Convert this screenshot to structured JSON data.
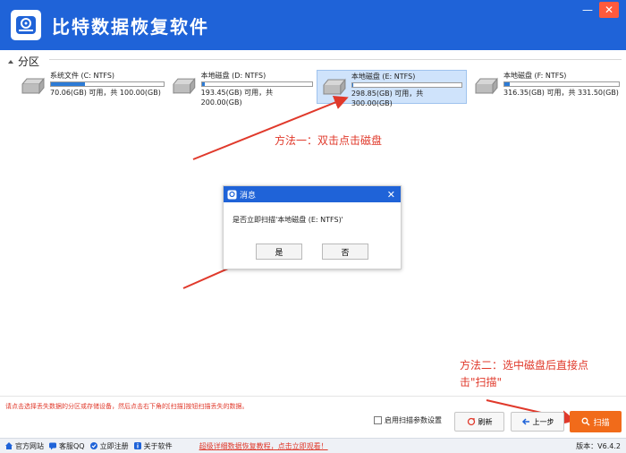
{
  "app": {
    "title": "比特数据恢复软件"
  },
  "window": {
    "minimize_glyph": "—",
    "close_glyph": "✕"
  },
  "partitions": {
    "title": "分区",
    "items": [
      {
        "name": "系统文件 (C: NTFS)",
        "usage": "70.06(GB) 可用，共 100.00(GB)",
        "fill": 0.3,
        "selected": false
      },
      {
        "name": "本地磁盘 (D: NTFS)",
        "usage": "193.45(GB) 可用，共 200.00(GB)",
        "fill": 0.03,
        "selected": false
      },
      {
        "name": "本地磁盘 (E: NTFS)",
        "usage": "298.85(GB) 可用，共 300.00(GB)",
        "fill": 0.01,
        "selected": true
      },
      {
        "name": "本地磁盘 (F: NTFS)",
        "usage": "316.35(GB) 可用，共 331.50(GB)",
        "fill": 0.05,
        "selected": false
      }
    ]
  },
  "annotations": {
    "method1": "方法一：双击点击磁盘",
    "method2_line1": "方法二：选中磁盘后直接点",
    "method2_line2": "击\"扫描\""
  },
  "dialog": {
    "title": "消息",
    "message": "是否立即扫描'本地磁盘 (E: NTFS)'",
    "yes": "是",
    "no": "否"
  },
  "bottom": {
    "hint": "请点击选择丢失数据的分区或存储设备，然后点击右下角的[扫描]按钮扫描丢失的数据。",
    "scan_settings": "启用扫描参数设置",
    "refresh": "刷新",
    "prev": "上一步",
    "scan": "扫描"
  },
  "statusbar": {
    "website": "官方网站",
    "qq": "客服QQ",
    "register": "立即注册",
    "about": "关于软件",
    "tutorial_link": "超级详细数据恢复教程，点击立即观看！",
    "version": "版本：V6.4.2"
  },
  "colors": {
    "brand": "#1f63d8",
    "accent": "#f16b1a",
    "annotation": "#e0392b"
  }
}
